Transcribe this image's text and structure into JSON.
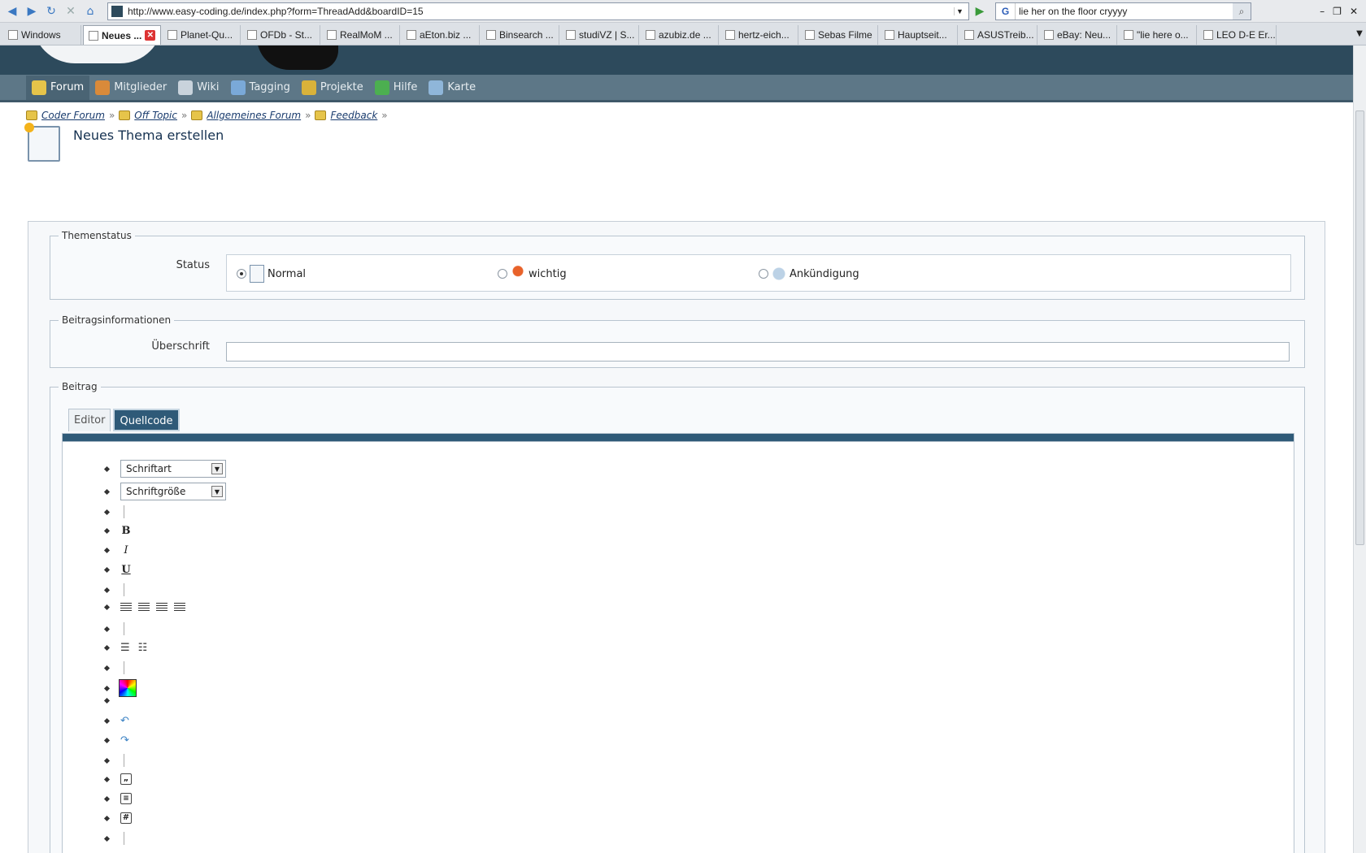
{
  "browser": {
    "url": "http://www.easy-coding.de/index.php?form=ThreadAdd&boardID=15",
    "search_engine": "G",
    "search_query": "lie her on the floor cryyyy",
    "tabs": [
      {
        "label": "Windows",
        "active": false
      },
      {
        "label": "Neues ...",
        "active": true
      },
      {
        "label": "Planet-Qu...",
        "active": false
      },
      {
        "label": "OFDb - St...",
        "active": false
      },
      {
        "label": "RealMoM ...",
        "active": false
      },
      {
        "label": "aEton.biz ...",
        "active": false
      },
      {
        "label": "Binsearch ...",
        "active": false
      },
      {
        "label": "studiVZ | S...",
        "active": false
      },
      {
        "label": "azubiz.de ...",
        "active": false
      },
      {
        "label": "hertz-eich...",
        "active": false
      },
      {
        "label": "Sebas Filme",
        "active": false
      },
      {
        "label": "Hauptseit...",
        "active": false
      },
      {
        "label": "ASUSTreib...",
        "active": false
      },
      {
        "label": "eBay: Neu...",
        "active": false
      },
      {
        "label": "\"lie here o...",
        "active": false
      },
      {
        "label": "LEO D-E Er...",
        "active": false
      }
    ]
  },
  "menu": {
    "items": [
      {
        "label": "Forum",
        "icon": "folder-icon",
        "color": "#e6c44a"
      },
      {
        "label": "Mitglieder",
        "icon": "users-icon",
        "color": "#d98a3a"
      },
      {
        "label": "Wiki",
        "icon": "pencil-icon",
        "color": "#c9d3dc"
      },
      {
        "label": "Tagging",
        "icon": "tag-icon",
        "color": "#7aa9d8"
      },
      {
        "label": "Projekte",
        "icon": "people-icon",
        "color": "#d9b23a"
      },
      {
        "label": "Hilfe",
        "icon": "help-icon",
        "color": "#4caf50"
      },
      {
        "label": "Karte",
        "icon": "globe-icon",
        "color": "#8fb6d9"
      }
    ]
  },
  "breadcrumb": [
    "Coder Forum",
    "Off Topic",
    "Allgemeines Forum",
    "Feedback"
  ],
  "breadcrumb_sep": "»",
  "page_title": "Neues Thema erstellen",
  "form": {
    "status_section": {
      "legend": "Themenstatus",
      "label": "Status",
      "options": [
        {
          "label": "Normal",
          "selected": true
        },
        {
          "label": "wichtig",
          "selected": false
        },
        {
          "label": "Ankündigung",
          "selected": false
        }
      ]
    },
    "info_section": {
      "legend": "Beitragsinformationen",
      "title_label": "Überschrift",
      "title_value": ""
    },
    "post_section": {
      "legend": "Beitrag",
      "tabs": [
        {
          "label": "Editor",
          "active": false
        },
        {
          "label": "Quellcode",
          "active": true
        }
      ],
      "toolbar": {
        "font_select": "Schriftart",
        "size_select": "Schriftgröße",
        "bold": "B",
        "italic": "I",
        "underline": "U",
        "quote_glyph": "„",
        "code_glyph": "#"
      }
    }
  },
  "colors": {
    "header_bg": "#2d4a5c",
    "menu_bg": "#5d7787",
    "editor_tab_active": "#2f5a78",
    "link": "#1a3c6e"
  }
}
